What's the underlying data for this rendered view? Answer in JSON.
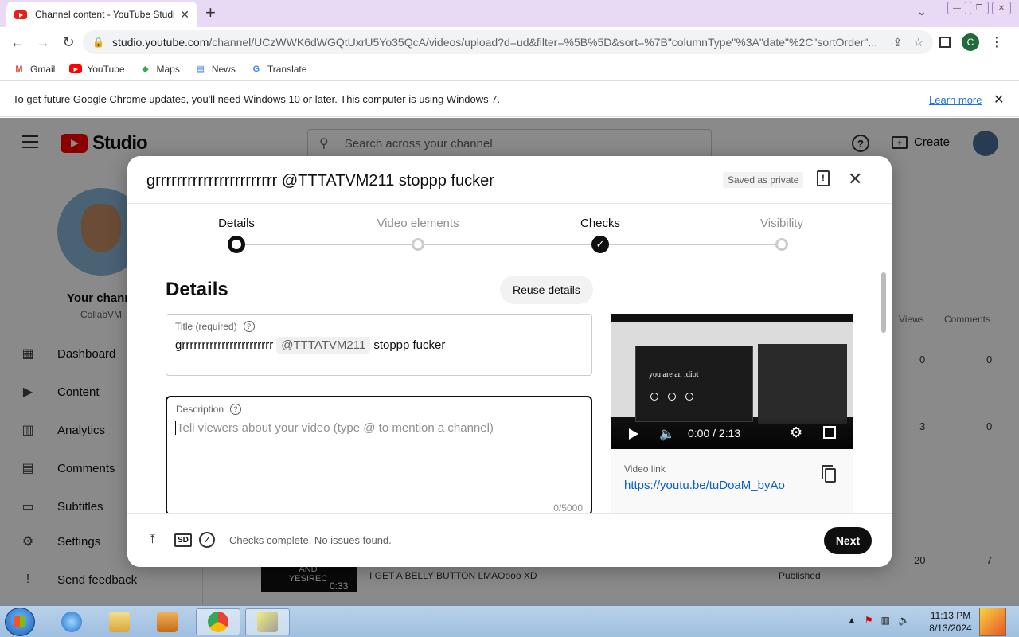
{
  "browser": {
    "tab_title": "Channel content - YouTube Studio",
    "url_domain": "studio.youtube.com",
    "url_rest": "/channel/UCzWWK6dWGQtUxrU5Yo35QcA/videos/upload?d=ud&filter=%5B%5D&sort=%7B\"columnType\"%3A\"date\"%2C\"sortOrder\"...",
    "profile_initial": "C",
    "bookmarks": [
      "Gmail",
      "YouTube",
      "Maps",
      "News",
      "Translate"
    ],
    "infobar_text": "To get future Google Chrome updates, you'll need Windows 10 or later. This computer is using Windows 7.",
    "infobar_link": "Learn more"
  },
  "studio": {
    "logo_text": "Studio",
    "search_placeholder": "Search across your channel",
    "create_label": "Create",
    "channel_title": "Your chann",
    "channel_sub": "CollabVM",
    "nav": [
      "Dashboard",
      "Content",
      "Analytics",
      "Comments",
      "Subtitles",
      "Settings",
      "Send feedback"
    ],
    "columns": {
      "views": "Views",
      "comments": "Comments"
    },
    "rows": [
      {
        "views": "0",
        "comments": "0"
      },
      {
        "views": "3",
        "comments": "0"
      },
      {
        "views": "20",
        "comments": "7"
      }
    ],
    "bottom_row": {
      "thumb_text": "AND YESIREC",
      "duration": "0:33",
      "title": "I GET A BELLY BUTTON LMAOooo XD",
      "status": "Published"
    }
  },
  "dialog": {
    "title": "grrrrrrrrrrrrrrrrrrrrrrr @TTTATVM211 stoppp fucker",
    "saved_badge": "Saved as private",
    "steps": [
      "Details",
      "Video elements",
      "Checks",
      "Visibility"
    ],
    "section_title": "Details",
    "reuse_label": "Reuse details",
    "title_field": {
      "label": "Title (required)",
      "part1": "grrrrrrrrrrrrrrrrrrrrrrr",
      "mention": "@TTTATVM211",
      "part2": "stoppp fucker"
    },
    "description_field": {
      "label": "Description",
      "placeholder": "Tell viewers about your video (type @ to mention a channel)",
      "count": "0/5000"
    },
    "preview": {
      "screen_text": "you are an idiot",
      "time": "0:00 / 2:13",
      "link_label": "Video link",
      "link_url": "https://youtu.be/tuDoaM_byAo"
    },
    "footer_status": "Checks complete. No issues found.",
    "footer_sd": "SD",
    "next_label": "Next"
  },
  "taskbar": {
    "time": "11:13 PM",
    "date": "8/13/2024"
  }
}
